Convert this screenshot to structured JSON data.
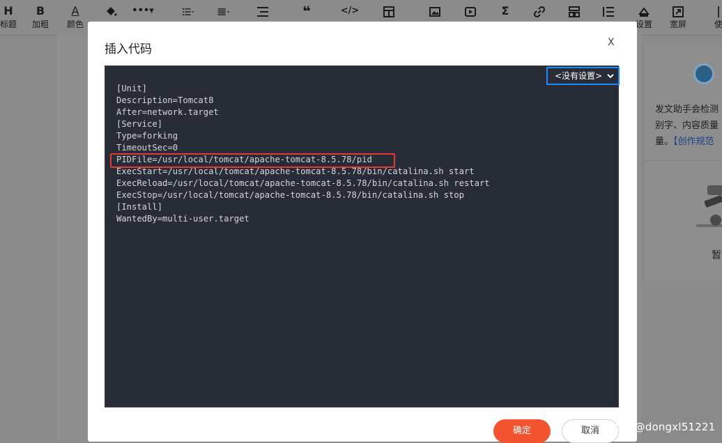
{
  "toolbar": {
    "items": [
      {
        "label": "标题",
        "icon": "H"
      },
      {
        "label": "加粗",
        "icon": "B"
      },
      {
        "label": "颜色",
        "icon": "A"
      },
      {
        "label": "",
        "icon": "paint-bucket"
      },
      {
        "label": "",
        "icon": "•••▾"
      },
      {
        "label": "",
        "icon": "list-bulleted"
      },
      {
        "label": "",
        "icon": "align"
      },
      {
        "label": "",
        "icon": "list-indent"
      },
      {
        "label": "",
        "icon": "❝"
      },
      {
        "label": "",
        "icon": "</>"
      },
      {
        "label": "",
        "icon": "table"
      },
      {
        "label": "",
        "icon": "image"
      },
      {
        "label": "",
        "icon": "video"
      },
      {
        "label": "",
        "icon": "Σ"
      },
      {
        "label": "",
        "icon": "link"
      },
      {
        "label": "",
        "icon": "template"
      },
      {
        "label": "",
        "icon": "list-numbered"
      },
      {
        "label": "设置",
        "icon": "settings-shape"
      },
      {
        "label": "宽屏",
        "icon": "expand"
      },
      {
        "label": "使",
        "icon": "|"
      }
    ]
  },
  "dialog": {
    "title": "插入代码",
    "close": "X",
    "language_select": "<没有设置>",
    "code_lines": [
      "[Unit]",
      "Description=Tomcat8",
      "After=network.target",
      "[Service]",
      "Type=forking",
      "TimeoutSec=0",
      "PIDFile=/usr/local/tomcat/apache-tomcat-8.5.78/pid",
      "ExecStart=/usr/local/tomcat/apache-tomcat-8.5.78/bin/catalina.sh start",
      "ExecReload=/usr/local/tomcat/apache-tomcat-8.5.78/bin/catalina.sh restart",
      "ExecStop=/usr/local/tomcat/apache-tomcat-8.5.78/bin/catalina.sh stop",
      "[Install]",
      "WantedBy=multi-user.target"
    ],
    "confirm": "确定",
    "cancel": "取消"
  },
  "side_panel": {
    "line1": "发文助手会检测",
    "line2": "别字、内容质量",
    "line3_prefix": "量。",
    "line3_link": "【创作规范",
    "caption": "暂"
  },
  "watermark": "CSDN @dongxl51221"
}
